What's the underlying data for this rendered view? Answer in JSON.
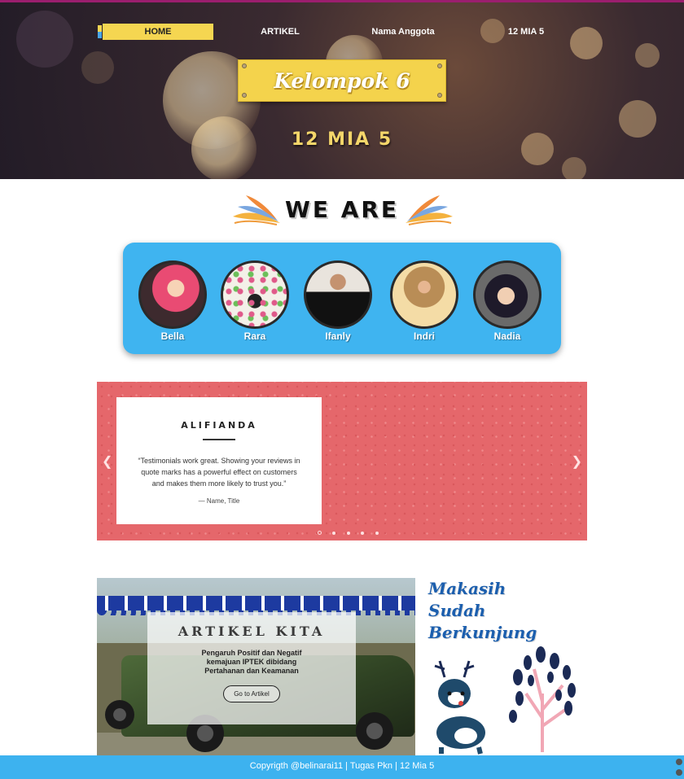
{
  "nav": {
    "items": [
      {
        "label": "HOME",
        "active": true
      },
      {
        "label": "ARTIKEL",
        "active": false
      },
      {
        "label": "Nama Anggota",
        "active": false
      },
      {
        "label": "12 MIA 5",
        "active": false
      }
    ]
  },
  "hero": {
    "title": "Kelompok 6",
    "subtitle": "12 MIA 5"
  },
  "section_heading": "WE ARE",
  "members": [
    {
      "name": "Bella"
    },
    {
      "name": "Rara"
    },
    {
      "name": "Ifanly"
    },
    {
      "name": "Indri"
    },
    {
      "name": "Nadia"
    }
  ],
  "testimonial": {
    "name": "ALIFIANDA",
    "quote": "“Testimonials work great. Showing your reviews in quote marks has a powerful effect on customers and makes them more likely to trust you.”",
    "signature": "— Name, Title",
    "prev_icon": "chevron-left-icon",
    "next_icon": "chevron-right-icon",
    "slide_count": 5,
    "active_slide": 1
  },
  "article": {
    "title": "ARTIKEL KITA",
    "description": "Pengaruh Positif dan Negatif kemajuan IPTEK dibidang Pertahanan dan Keamanan",
    "button_label": "Go to Artikel"
  },
  "thanks": {
    "line1": "Makasih",
    "line2": "Sudah",
    "line3": "Berkunjung"
  },
  "footer": {
    "text": "Copyrigth @belinarai11 | Tugas Pkn | 12 Mia 5"
  },
  "colors": {
    "accent_yellow": "#f5d651",
    "accent_blue": "#3fb4f0",
    "slider_bg": "#e5676b",
    "thanks_blue": "#1c5fae"
  }
}
